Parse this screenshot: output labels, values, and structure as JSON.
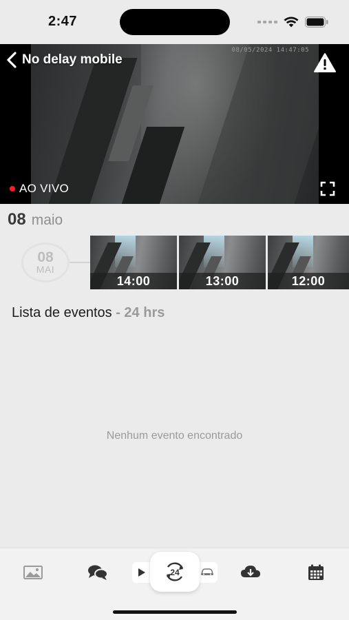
{
  "status_bar": {
    "time": "2:47"
  },
  "video": {
    "camera_name": "No delay mobile",
    "timestamp": "08/05/2024 14:47:05",
    "live_label": "AO VIVO"
  },
  "date_header": {
    "day": "08",
    "month": "maio"
  },
  "timeline": {
    "date_day": "08",
    "date_month": "MAI",
    "thumbnails": [
      {
        "time": "14:00"
      },
      {
        "time": "13:00"
      },
      {
        "time": "12:00"
      }
    ]
  },
  "events": {
    "title": "Lista de eventos",
    "period": " - 24 hrs",
    "empty_message": "Nenhum evento encontrado"
  },
  "tab_bar": {
    "tabs": [
      "image-icon",
      "chat-icon",
      "play-icon",
      "24h-icon",
      "car-icon",
      "cloud-download-icon",
      "calendar-icon"
    ]
  },
  "colors": {
    "live_dot": "#ff1e1e",
    "background": "#ebebeb",
    "muted_text": "#9a9a9a"
  }
}
